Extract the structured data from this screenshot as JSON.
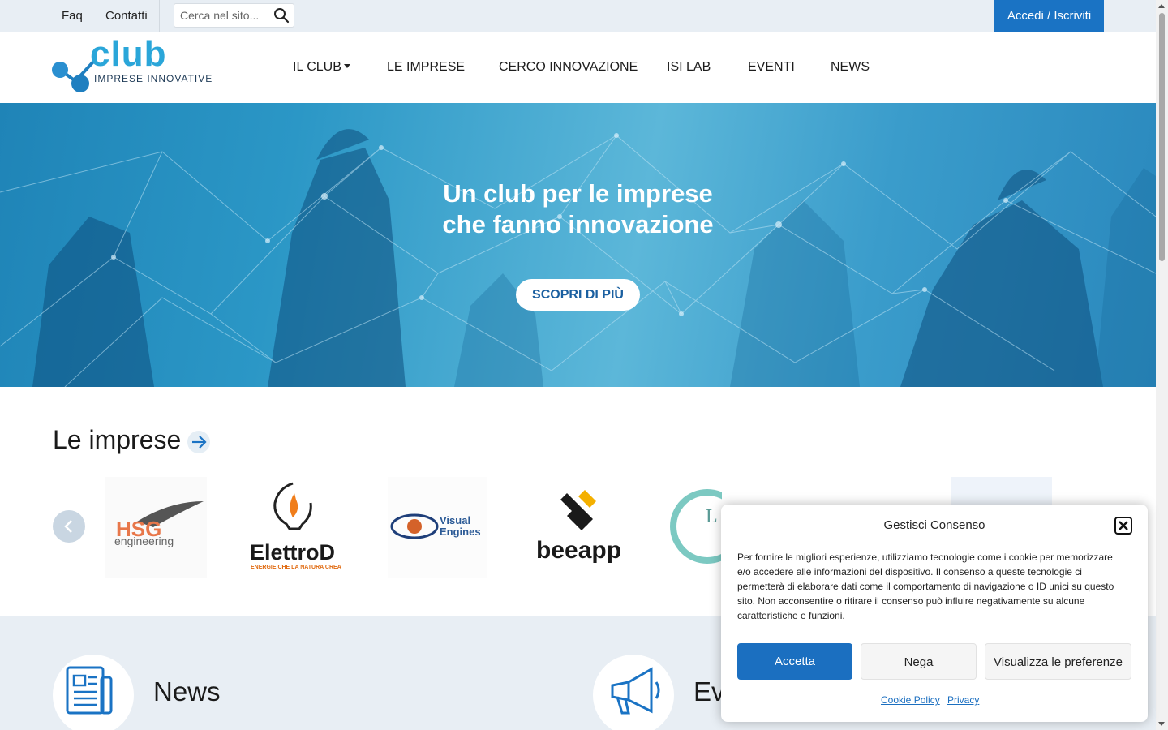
{
  "topbar": {
    "faq": "Faq",
    "contatti": "Contatti",
    "search_placeholder": "Cerca nel sito...",
    "login": "Accedi / Iscriviti"
  },
  "logo": {
    "word": "club",
    "subtitle": "IMPRESE INNOVATIVE"
  },
  "nav": {
    "club": "IL CLUB",
    "imprese": "LE IMPRESE",
    "cerco": "CERCO INNOVAZIONE",
    "isilab": "ISI LAB",
    "eventi": "EVENTI",
    "news": "NEWS"
  },
  "hero": {
    "title_line1": "Un club per le imprese",
    "title_line2": "che fanno innovazione",
    "cta": "SCOPRI DI PIÙ"
  },
  "imprese": {
    "title": "Le imprese",
    "logos": {
      "hsg": {
        "brand": "HSG",
        "sub": "engineering"
      },
      "elettrod": {
        "brand": "ElettroD",
        "sub": "ENERGIE CHE LA NATURA CREA"
      },
      "visual": {
        "brand": "Visual",
        "brand2": "Engines"
      },
      "beeapp": {
        "brand": "beeapp"
      },
      "partial": "L"
    }
  },
  "bottom": {
    "news": "News",
    "eventi": "Ev"
  },
  "cookie": {
    "title": "Gestisci Consenso",
    "text": "Per fornire le migliori esperienze, utilizziamo tecnologie come i cookie per memorizzare e/o accedere alle informazioni del dispositivo. Il consenso a queste tecnologie ci permetterà di elaborare dati come il comportamento di navigazione o ID unici su questo sito. Non acconsentire o ritirare il consenso può influire negativamente su alcune caratteristiche e funzioni.",
    "accept": "Accetta",
    "deny": "Nega",
    "prefs": "Visualizza le preferenze",
    "cookie_policy": "Cookie Policy",
    "privacy": "Privacy"
  },
  "colors": {
    "brand_blue": "#1a73c4",
    "logo_cyan": "#2aa6d9",
    "section_bg": "#e8eef4"
  }
}
